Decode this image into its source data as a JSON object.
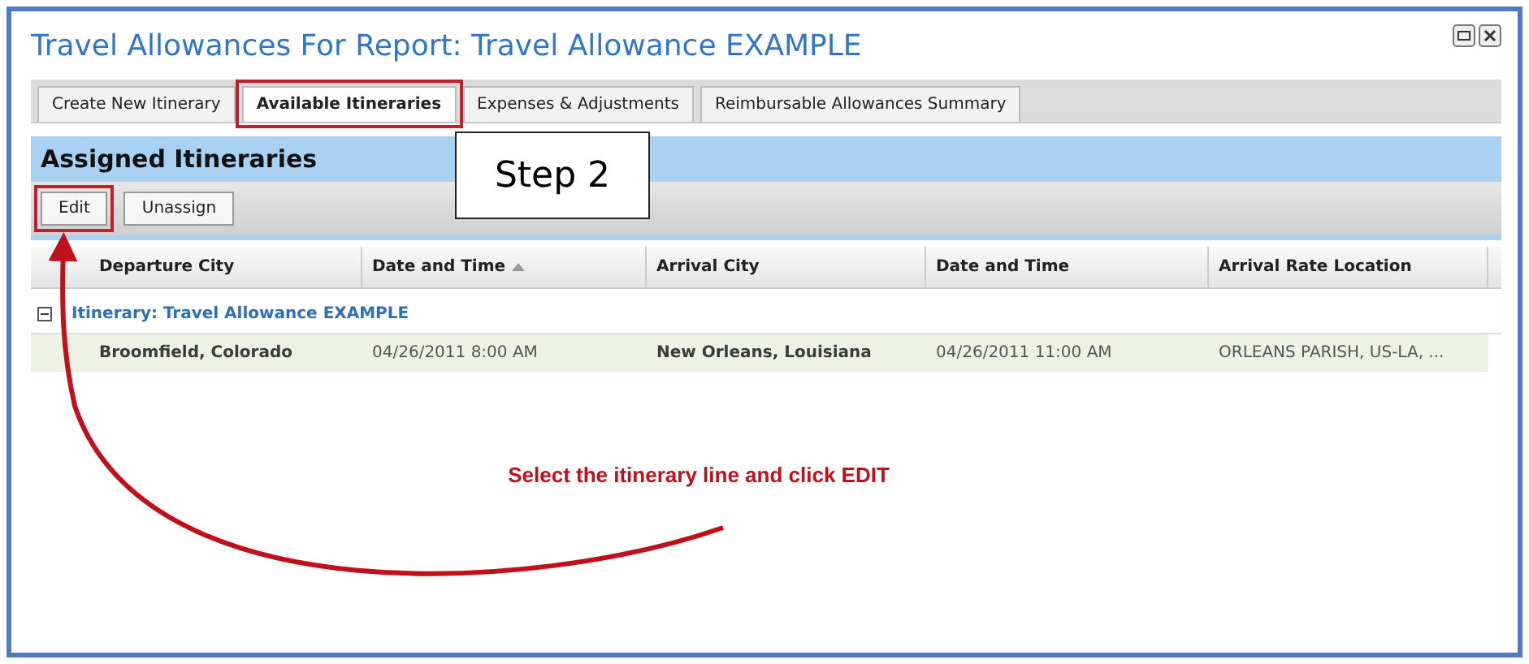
{
  "window": {
    "title": "Travel Allowances For Report: Travel Allowance EXAMPLE"
  },
  "tabs": [
    {
      "label": "Create New Itinerary",
      "selected": false,
      "highlighted": false
    },
    {
      "label": "Available Itineraries",
      "selected": true,
      "highlighted": true
    },
    {
      "label": "Expenses & Adjustments",
      "selected": false,
      "highlighted": false
    },
    {
      "label": "Reimbursable Allowances Summary",
      "selected": false,
      "highlighted": false
    }
  ],
  "section_title": "Assigned Itineraries",
  "buttons": [
    {
      "label": "Edit",
      "highlighted": true
    },
    {
      "label": "Unassign",
      "highlighted": false
    }
  ],
  "table": {
    "columns": [
      {
        "label": "Departure City",
        "sorted": false
      },
      {
        "label": "Date and Time",
        "sorted": true
      },
      {
        "label": "Arrival City",
        "sorted": false
      },
      {
        "label": "Date and Time",
        "sorted": false
      },
      {
        "label": "Arrival Rate Location",
        "sorted": false
      }
    ],
    "groups": [
      {
        "label": "Itinerary: Travel Allowance EXAMPLE",
        "expanded": true,
        "rows": [
          {
            "selected": true,
            "cells": [
              "Broomfield, Colorado",
              "04/26/2011 8:00 AM",
              "New Orleans, Louisiana",
              "04/26/2011 11:00 AM",
              "ORLEANS PARISH, US-LA, ..."
            ]
          }
        ]
      }
    ]
  },
  "callout": "Step 2",
  "annotation": "Select the itinerary line and click EDIT"
}
